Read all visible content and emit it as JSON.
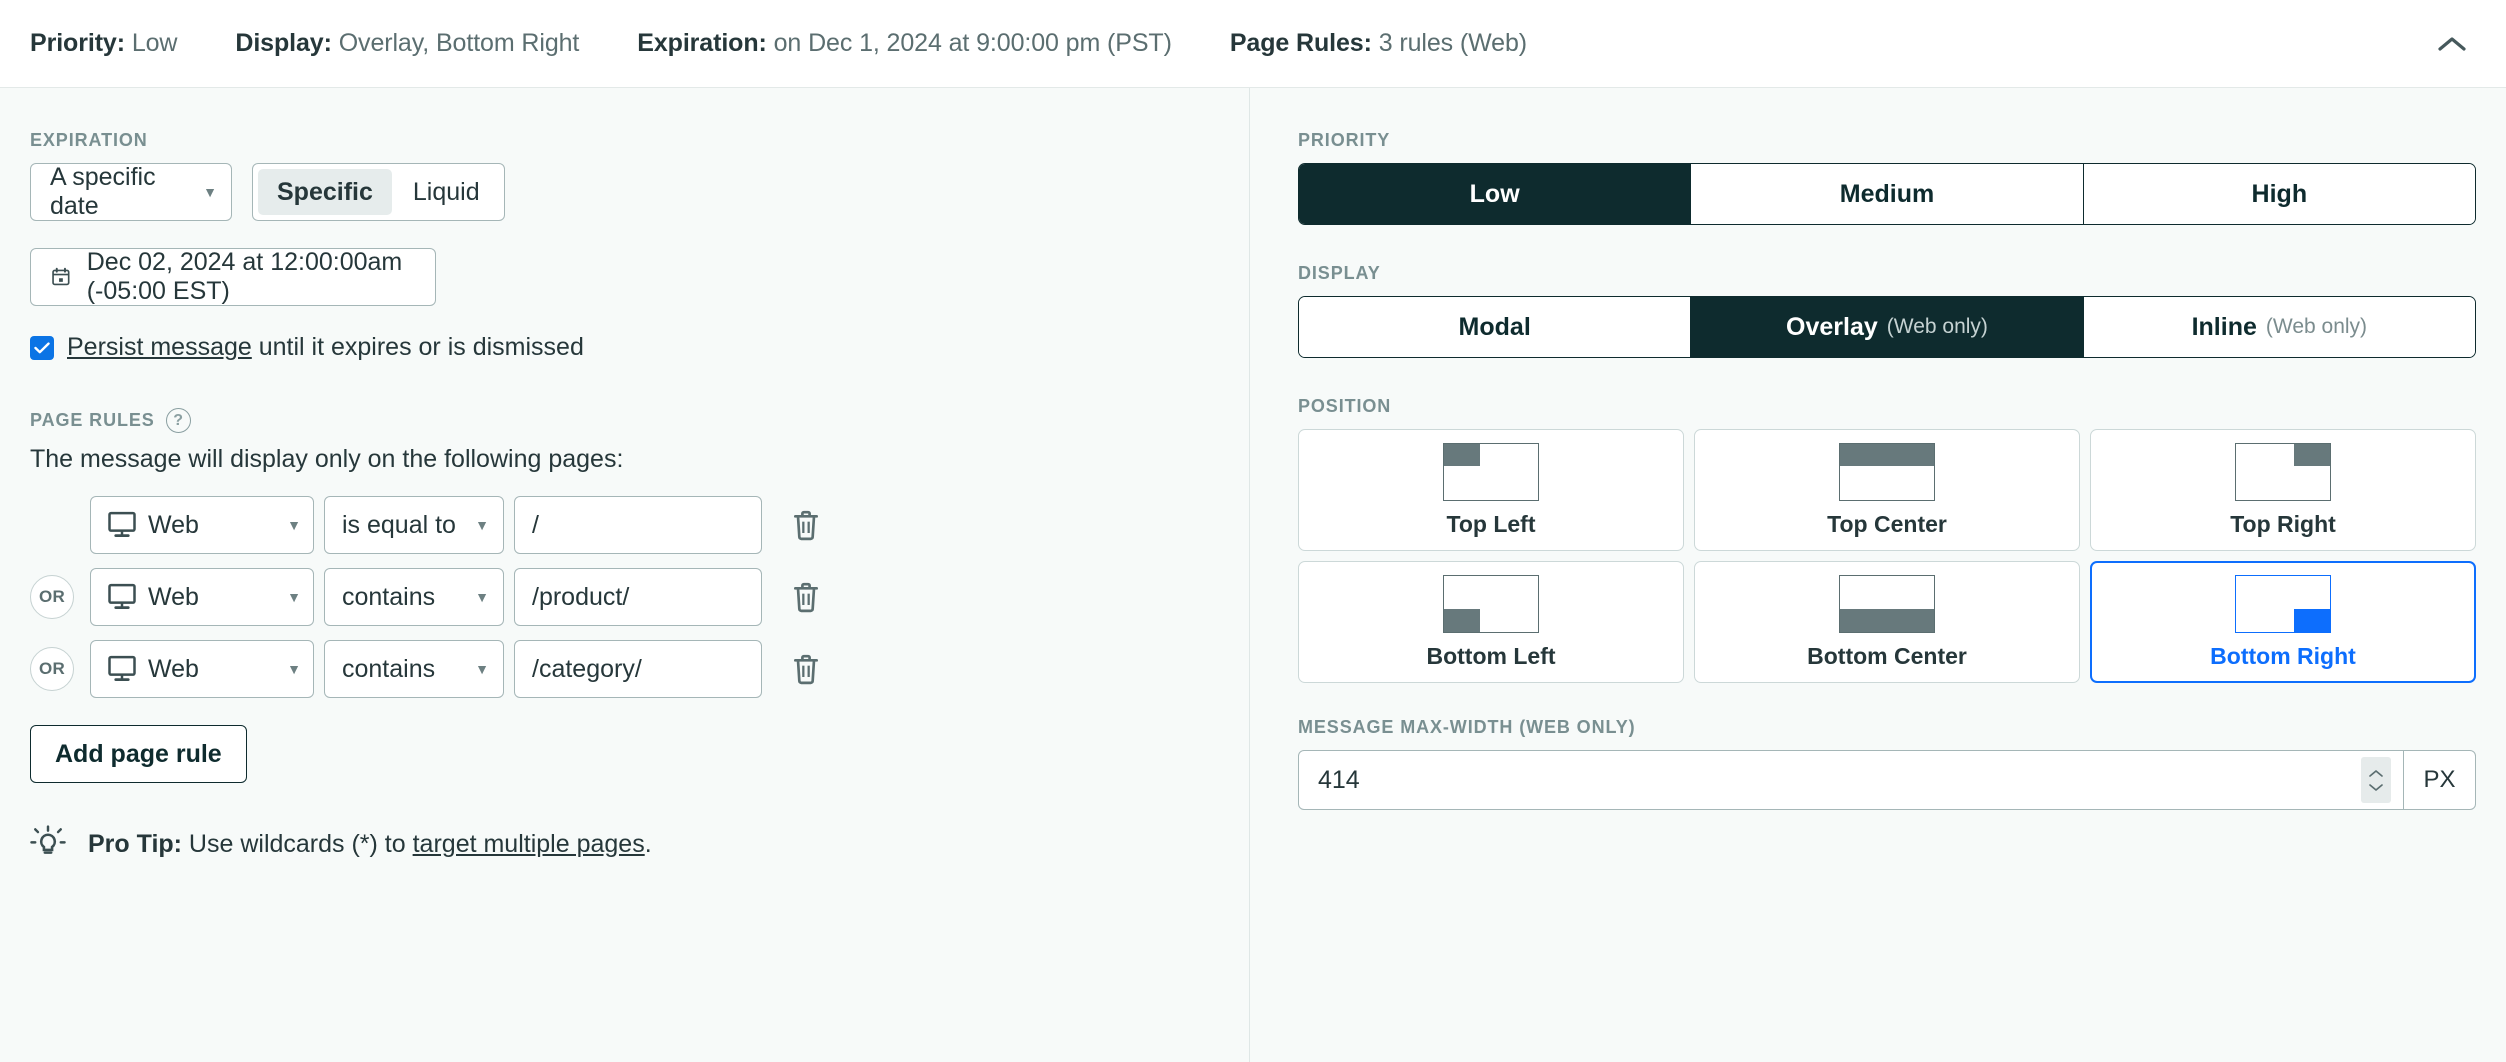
{
  "summary": {
    "items": [
      {
        "label": "Priority:",
        "value": "Low"
      },
      {
        "label": "Display:",
        "value": "Overlay, Bottom Right"
      },
      {
        "label": "Expiration:",
        "value": "on Dec 1, 2024 at 9:00:00 pm (PST)"
      },
      {
        "label": "Page Rules:",
        "value": "3 rules (Web)"
      }
    ],
    "collapse_icon": "chevron-up-icon"
  },
  "expiration": {
    "section_label": "EXPIRATION",
    "type_select": {
      "value": "A specific date",
      "caret": "▼"
    },
    "mode_toggle": {
      "options": [
        "Specific",
        "Liquid"
      ],
      "active": "Specific"
    },
    "date_value": "Dec 02, 2024 at 12:00:00am (-05:00 EST)",
    "date_icon": "calendar-icon",
    "persist": {
      "checked": true,
      "link_text": "Persist message",
      "rest_text": " until it expires or is dismissed"
    }
  },
  "page_rules": {
    "section_label": "PAGE RULES",
    "help_icon": "question-mark-icon",
    "description": "The message will display only on the following pages:",
    "rules": [
      {
        "connector": "",
        "source": "Web",
        "source_icon": "monitor-icon",
        "operator": "is equal to",
        "value": "/",
        "delete_icon": "trash-icon"
      },
      {
        "connector": "OR",
        "source": "Web",
        "source_icon": "monitor-icon",
        "operator": "contains",
        "value": "/product/",
        "delete_icon": "trash-icon"
      },
      {
        "connector": "OR",
        "source": "Web",
        "source_icon": "monitor-icon",
        "operator": "contains",
        "value": "/category/",
        "delete_icon": "trash-icon"
      }
    ],
    "add_button": "Add page rule",
    "pro_tip": {
      "icon": "lightbulb-icon",
      "bold": "Pro Tip:",
      "text": " Use wildcards (*) to ",
      "link": "target multiple pages",
      "tail": "."
    }
  },
  "priority": {
    "section_label": "PRIORITY",
    "options": [
      "Low",
      "Medium",
      "High"
    ],
    "active": "Low"
  },
  "display": {
    "section_label": "DISPLAY",
    "options": [
      {
        "label": "Modal",
        "sub": ""
      },
      {
        "label": "Overlay",
        "sub": "(Web only)"
      },
      {
        "label": "Inline",
        "sub": "(Web only)"
      }
    ],
    "active": "Overlay"
  },
  "position": {
    "section_label": "POSITION",
    "cells": [
      {
        "label": "Top Left",
        "v": "top",
        "h": "left",
        "selected": false
      },
      {
        "label": "Top Center",
        "v": "top",
        "h": "center",
        "selected": false
      },
      {
        "label": "Top Right",
        "v": "top",
        "h": "right",
        "selected": false
      },
      {
        "label": "Bottom Left",
        "v": "bottom",
        "h": "left",
        "selected": false
      },
      {
        "label": "Bottom Center",
        "v": "bottom",
        "h": "center",
        "selected": false
      },
      {
        "label": "Bottom Right",
        "v": "bottom",
        "h": "right",
        "selected": true
      }
    ]
  },
  "max_width": {
    "section_label": "MESSAGE MAX-WIDTH (WEB ONLY)",
    "value": "414",
    "unit": "PX",
    "stepper_icon": "stepper-updown-icon"
  },
  "colors": {
    "accent_dark": "#0e2b2e",
    "selected_blue": "#0d6efd",
    "checkbox_blue": "#0b74e5",
    "thumb_gray": "#67797c",
    "page_bg": "#f7faf9"
  }
}
